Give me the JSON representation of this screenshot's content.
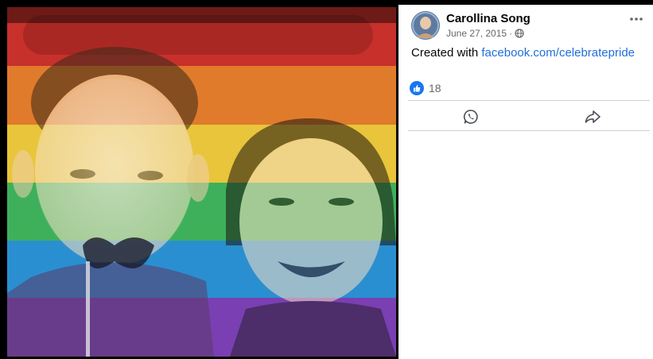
{
  "post": {
    "author": "Carollina Song",
    "date": "June 27, 2015",
    "separator": "·",
    "privacy_icon": "globe-icon",
    "text_prefix": "Created with",
    "link_text": "facebook.com/celebratepride",
    "like_count": "18"
  },
  "photo": {
    "overlay": "rainbow-pride-filter",
    "stripe_colors": [
      "#c8302b",
      "#e07b2b",
      "#e8c53a",
      "#3eb05c",
      "#2a8fd0",
      "#7a3fb2"
    ]
  },
  "actions": [
    {
      "icon": "whatsapp-icon"
    },
    {
      "icon": "share-icon"
    }
  ],
  "colors": {
    "link": "#216fdb",
    "like_blue": "#1877f2",
    "muted": "#65676b"
  }
}
